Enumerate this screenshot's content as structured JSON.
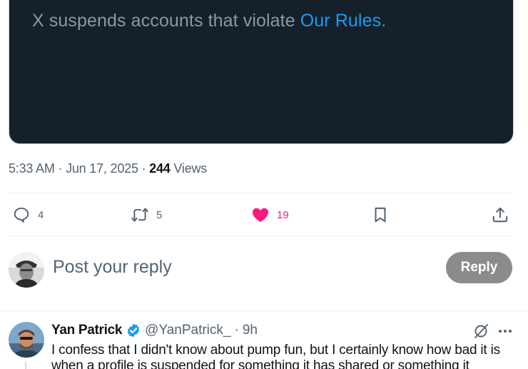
{
  "embed": {
    "text": "X suspends accounts that violate ",
    "link": "Our Rules",
    "period": "."
  },
  "meta": {
    "time": "5:33 AM",
    "sep1": " · ",
    "date": "Jun 17, 2025",
    "sep2": " · ",
    "views_count": "244",
    "views_label": " Views"
  },
  "actions": {
    "replies": "4",
    "reposts": "5",
    "likes": "19",
    "like_color": "#f91880"
  },
  "composer": {
    "placeholder": "Post your reply",
    "reply_label": "Reply"
  },
  "reply": {
    "name": "Yan Patrick",
    "handle": "@YanPatrick_",
    "dot": " · ",
    "time": "9h",
    "text": "I confess that I didn't know about pump fun, but I certainly know how bad it is when a profile is suspended for something it has shared or something it"
  },
  "icons": {
    "reply": "comment-icon",
    "repost": "repost-icon",
    "like": "heart-icon",
    "bookmark": "bookmark-icon",
    "share": "share-icon",
    "verified": "verified-badge-icon",
    "grok": "grok-icon",
    "more": "more-icon"
  }
}
